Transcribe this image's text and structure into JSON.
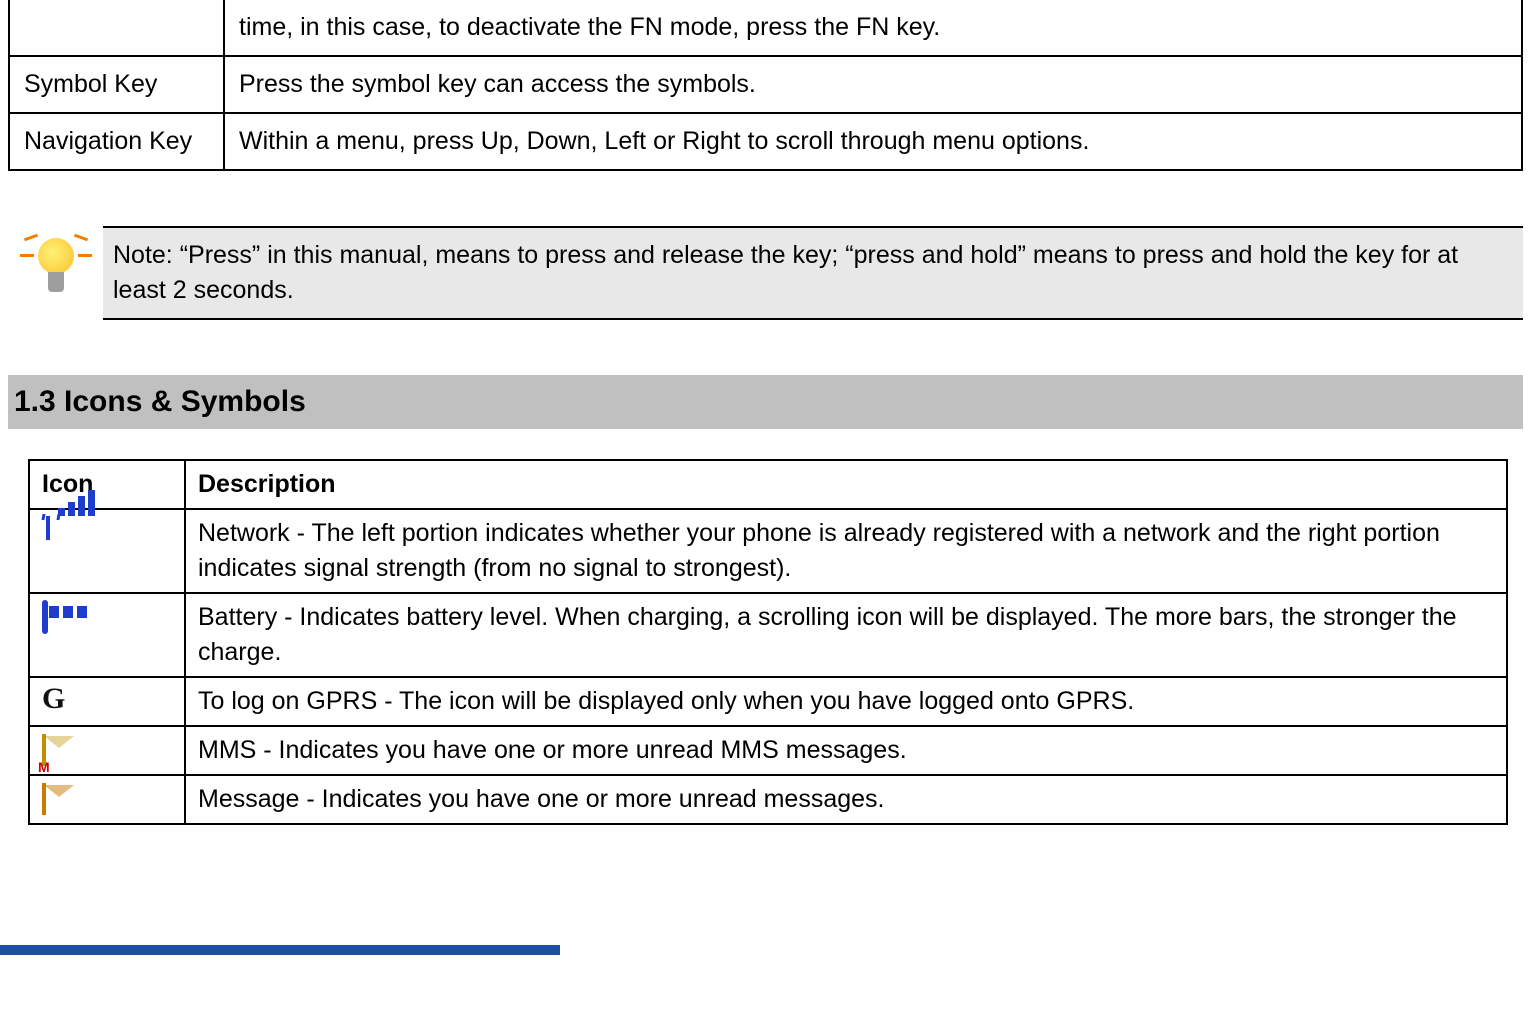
{
  "keys_table": {
    "rows": [
      {
        "name_html": "",
        "value_html": "time, in this case, to deactivate the FN mode, press the FN key."
      },
      {
        "name_html": "Symbol Key",
        "value_html": "Press the symbol key can access the symbols."
      },
      {
        "name_html": "Navigation Key",
        "value_html": "Within a menu, press Up, Down, Left or Right to scroll through menu options."
      }
    ]
  },
  "note_text": "Note: “Press” in this manual, means to press and release the key; “press and hold” means to press and hold the key for at least 2 seconds.",
  "section_heading": "1.3 Icons & Symbols",
  "icons_table": {
    "header_icon": "Icon",
    "header_desc": "Description",
    "rows": [
      {
        "icon_name": "signal-icon",
        "desc": "Network - The left portion indicates whether your phone is already registered with a network and the right portion indicates signal strength (from no signal to strongest)."
      },
      {
        "icon_name": "battery-icon",
        "desc": "Battery - Indicates battery level. When charging, a scrolling icon will be displayed. The more bars, the stronger the charge."
      },
      {
        "icon_name": "gprs-icon",
        "desc": "To log on GPRS - The icon will be displayed only when you have logged onto GPRS."
      },
      {
        "icon_name": "mms-icon",
        "desc": "MMS - Indicates you have one or more unread MMS messages."
      },
      {
        "icon_name": "message-icon",
        "desc": "Message - Indicates you have one or more unread messages."
      }
    ]
  }
}
